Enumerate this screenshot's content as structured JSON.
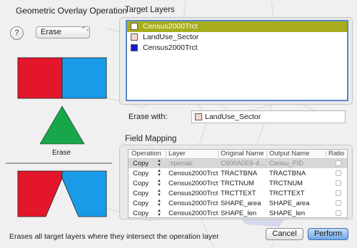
{
  "window": {
    "operation_title": "Geometric Overlay Operation",
    "help_label": "?",
    "operation_select": {
      "selected": "Erase",
      "chevron": "⌃⌄"
    },
    "diagram_caption": "Erase",
    "status_text": "Erases all target layers where they intersect the operation layer",
    "cancel_label": "Cancel",
    "perform_label": "Perform"
  },
  "colors": {
    "red": "#e4162b",
    "blue": "#199be8",
    "green": "#17a64a",
    "selection": "#a7ad1c",
    "accent": "#3f6fb8"
  },
  "target_layers": {
    "title": "Target Layers",
    "items": [
      {
        "name": "Census2000Trct",
        "swatch": "#ffffff",
        "selected": true
      },
      {
        "name": "LandUse_Sector",
        "swatch": "#f6d7cf",
        "selected": false
      },
      {
        "name": "Census2000Trct",
        "swatch": "#1a1ad6",
        "selected": false
      }
    ]
  },
  "erase_with": {
    "label": "Erase with:",
    "value": "LandUse_Sector",
    "swatch": "#f6d7cf"
  },
  "field_mapping": {
    "title": "Field Mapping",
    "columns": [
      "Operation",
      "Layer",
      "Original Name",
      "Output Name",
      "Ratio"
    ],
    "rows": [
      {
        "operation": "Copy",
        "layer": ":special:",
        "original": "C600A0E6-4…",
        "output": "Censu_FID",
        "ratio": false,
        "special": true
      },
      {
        "operation": "Copy",
        "layer": "Census2000Trct",
        "original": "TRACTBNA",
        "output": "TRACTBNA",
        "ratio": false
      },
      {
        "operation": "Copy",
        "layer": "Census2000Trct",
        "original": "TRCTNUM",
        "output": "TRCTNUM",
        "ratio": false
      },
      {
        "operation": "Copy",
        "layer": "Census2000Trct",
        "original": "TRCTTEXT",
        "output": "TRCTTEXT",
        "ratio": false
      },
      {
        "operation": "Copy",
        "layer": "Census2000Trct",
        "original": "SHAPE_area",
        "output": "SHAPE_area",
        "ratio": false
      },
      {
        "operation": "Copy",
        "layer": "Census2000Trct",
        "original": "SHAPE_len",
        "output": "SHAPE_len",
        "ratio": false
      }
    ]
  }
}
